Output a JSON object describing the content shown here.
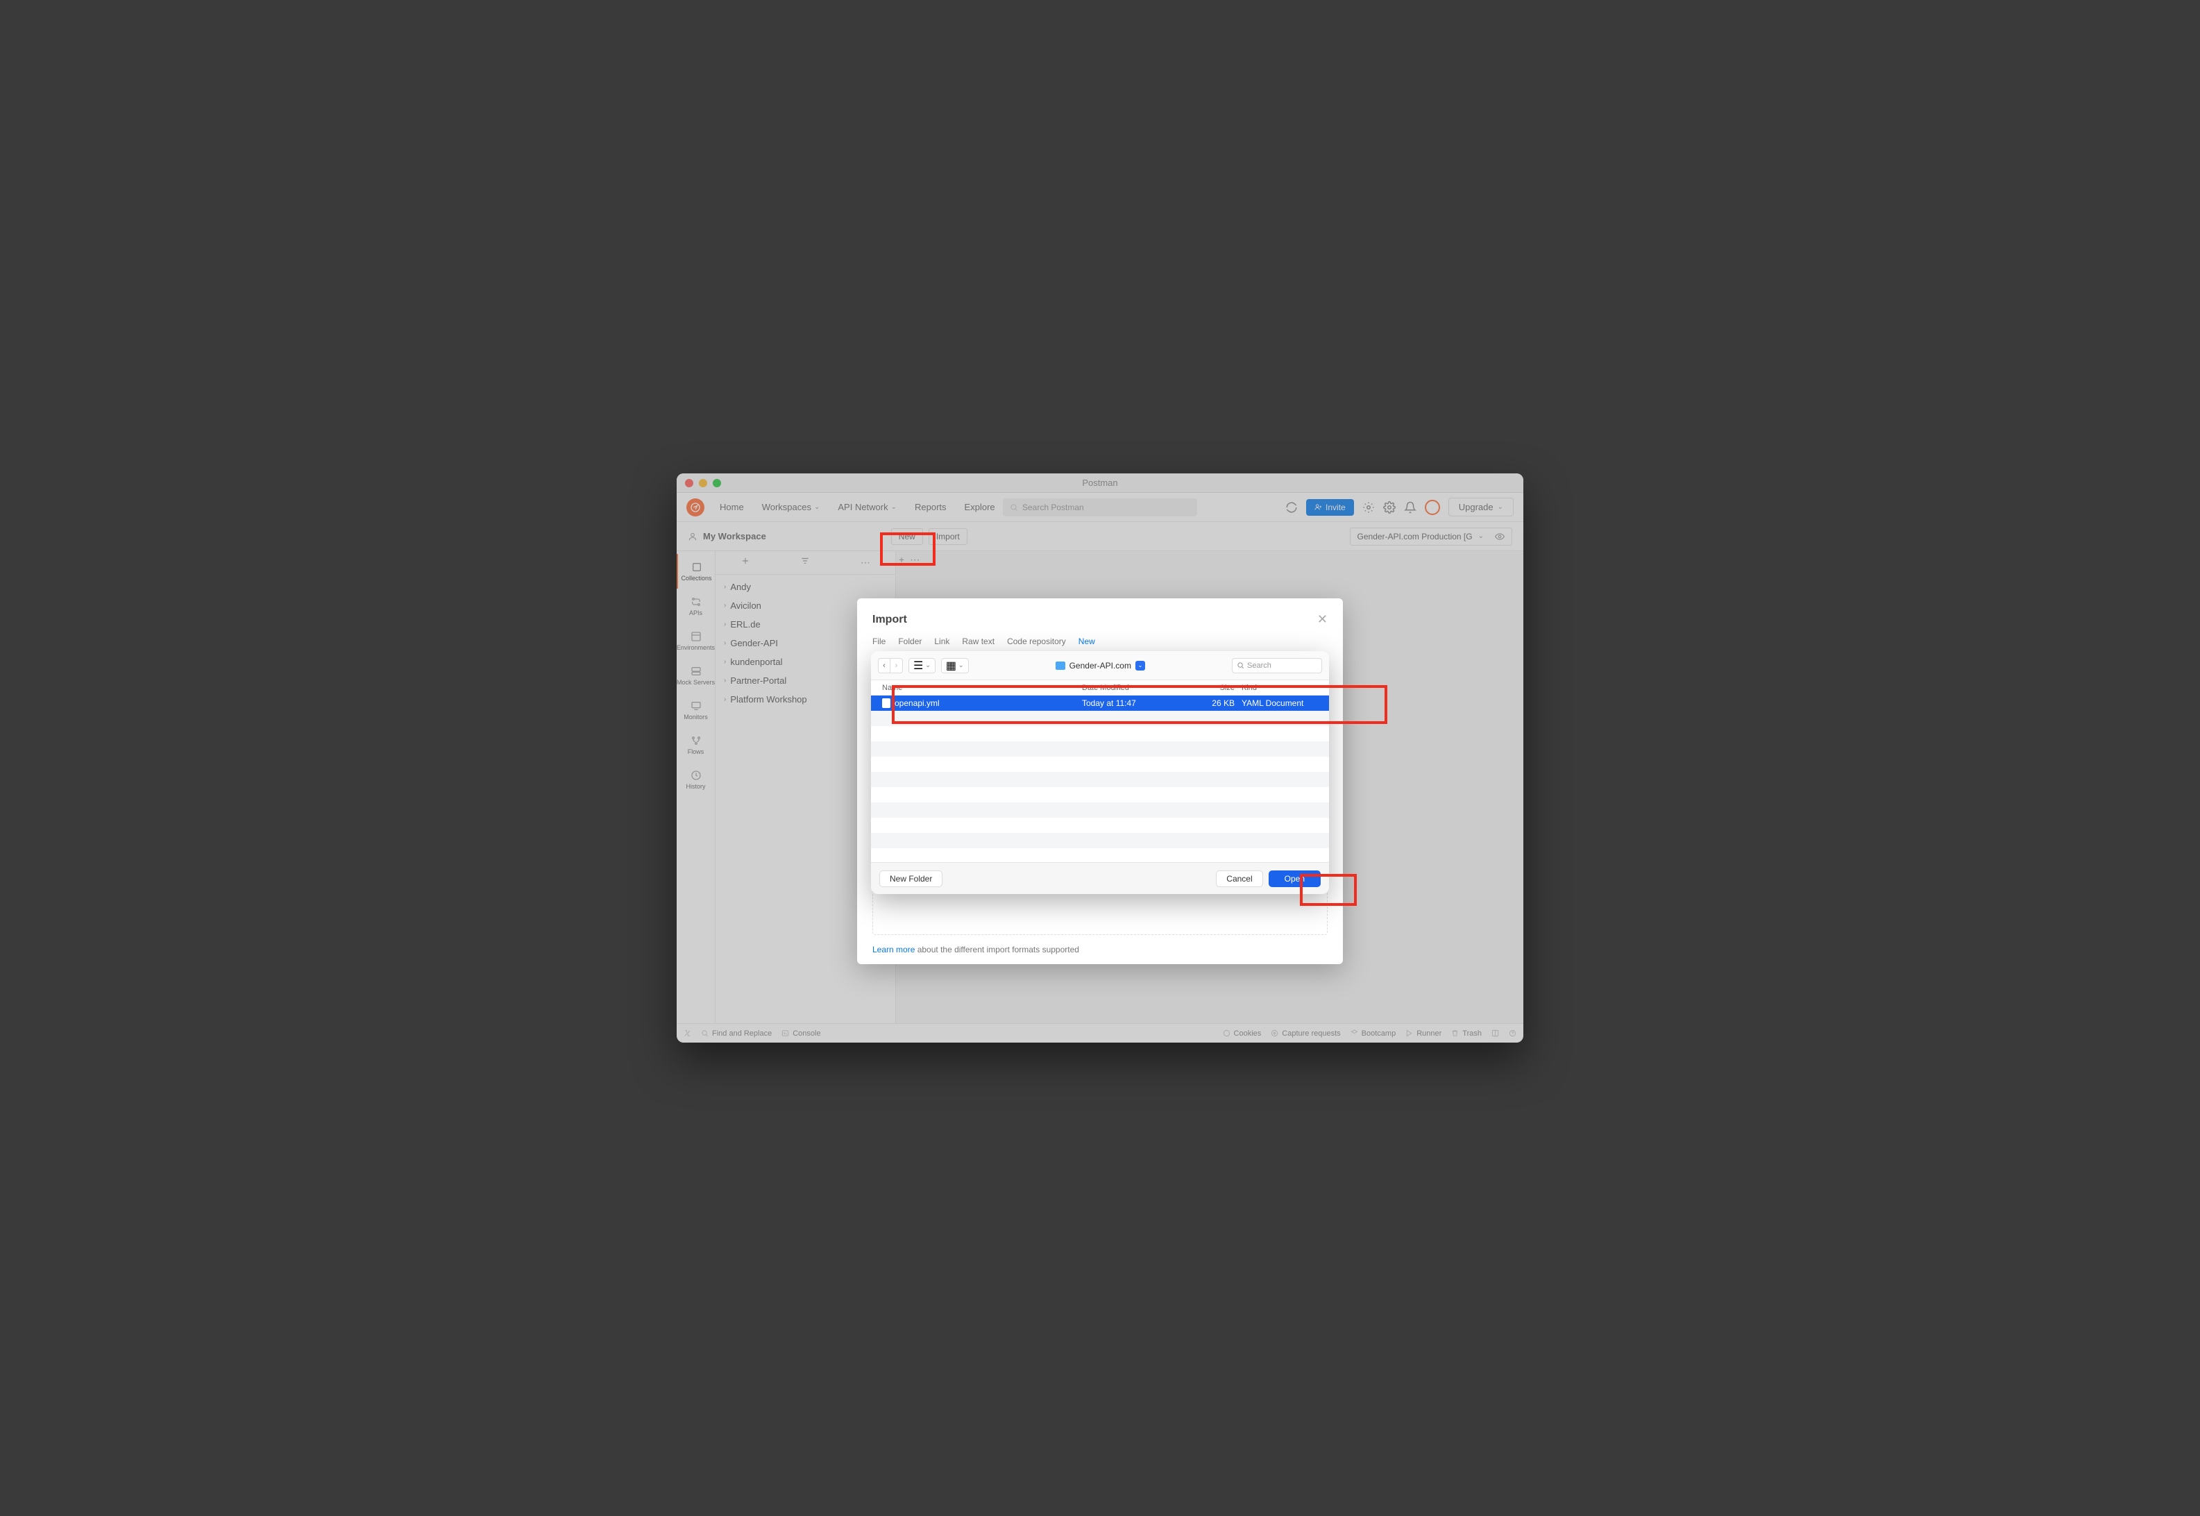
{
  "titlebar": {
    "app_name": "Postman"
  },
  "topnav": {
    "home": "Home",
    "workspaces": "Workspaces",
    "api_network": "API Network",
    "reports": "Reports",
    "explore": "Explore",
    "search_placeholder": "Search Postman",
    "invite": "Invite",
    "upgrade": "Upgrade"
  },
  "subbar": {
    "workspace": "My Workspace",
    "new": "New",
    "import": "Import",
    "environment": "Gender-API.com Production [G"
  },
  "rail": {
    "collections": "Collections",
    "apis": "APIs",
    "environments": "Environments",
    "mock": "Mock Servers",
    "monitors": "Monitors",
    "flows": "Flows",
    "history": "History"
  },
  "collections": [
    "Andy",
    "Avicilon",
    "ERL.de",
    "Gender-API",
    "kundenportal",
    "Partner-Portal",
    "Platform Workshop"
  ],
  "footer": {
    "find": "Find and Replace",
    "console": "Console",
    "cookies": "Cookies",
    "capture": "Capture requests",
    "bootcamp": "Bootcamp",
    "runner": "Runner",
    "trash": "Trash"
  },
  "import_modal": {
    "title": "Import",
    "tabs": {
      "file": "File",
      "folder": "Folder",
      "link": "Link",
      "raw": "Raw text",
      "repo": "Code repository",
      "new": "New"
    },
    "learn_more": "Learn more",
    "learn_more_suffix": " about the different import formats supported"
  },
  "file_dialog": {
    "path": "Gender-API.com",
    "search_placeholder": "Search",
    "columns": {
      "name": "Name",
      "modified": "Date Modified",
      "size": "Size",
      "kind": "Kind"
    },
    "rows": [
      {
        "name": "openapi.yml",
        "modified": "Today at 11:47",
        "size": "26 KB",
        "kind": "YAML Document",
        "selected": true
      }
    ],
    "new_folder": "New Folder",
    "cancel": "Cancel",
    "open": "Open"
  }
}
